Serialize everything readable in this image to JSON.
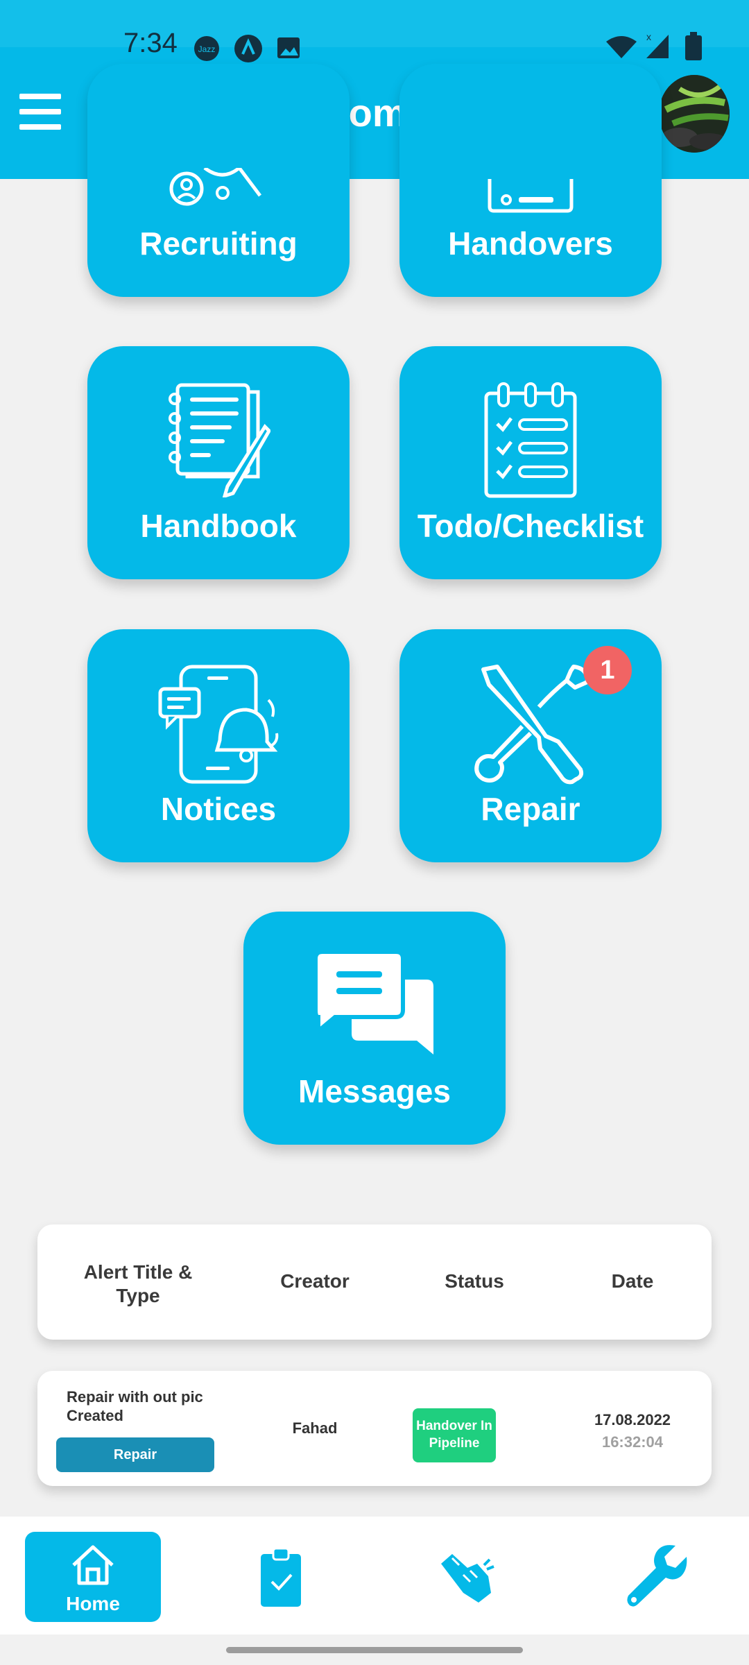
{
  "status_bar": {
    "time": "7:34",
    "icons": [
      "jazz-icon",
      "navigation-arrow-icon",
      "image-icon",
      "wifi-icon",
      "signal-icon",
      "battery-icon"
    ]
  },
  "header": {
    "title": "Home",
    "menu_icon": "hamburger-menu-icon",
    "avatar": "profile-avatar"
  },
  "tiles": [
    {
      "label": "Recruiting",
      "icon": "recruiting-icon"
    },
    {
      "label": "Handovers",
      "icon": "handovers-icon"
    },
    {
      "label": "Handbook",
      "icon": "handbook-icon"
    },
    {
      "label": "Todo/Checklist",
      "icon": "checklist-icon"
    },
    {
      "label": "Notices",
      "icon": "notices-icon"
    },
    {
      "label": "Repair",
      "icon": "repair-icon",
      "badge": "1"
    },
    {
      "label": "Messages",
      "icon": "messages-icon"
    }
  ],
  "alerts_table": {
    "headers": {
      "title_type": "Alert Title & Type",
      "creator": "Creator",
      "status": "Status",
      "date": "Date"
    },
    "rows": [
      {
        "title": "Repair with out pic Created",
        "type": "Repair",
        "creator": "Fahad",
        "status": "Handover In Pipeline",
        "date": "17.08.2022",
        "time": "16:32:04"
      }
    ]
  },
  "bottom_nav": {
    "home_label": "Home",
    "items": [
      "home-icon",
      "clipboard-check-icon",
      "handshake-icon",
      "wrench-icon"
    ]
  },
  "colors": {
    "primary": "#04b9e8",
    "badge": "#f16464",
    "status_green": "#1fcf7f",
    "type_button": "#1a8fb5",
    "background": "#f1f1f1"
  }
}
